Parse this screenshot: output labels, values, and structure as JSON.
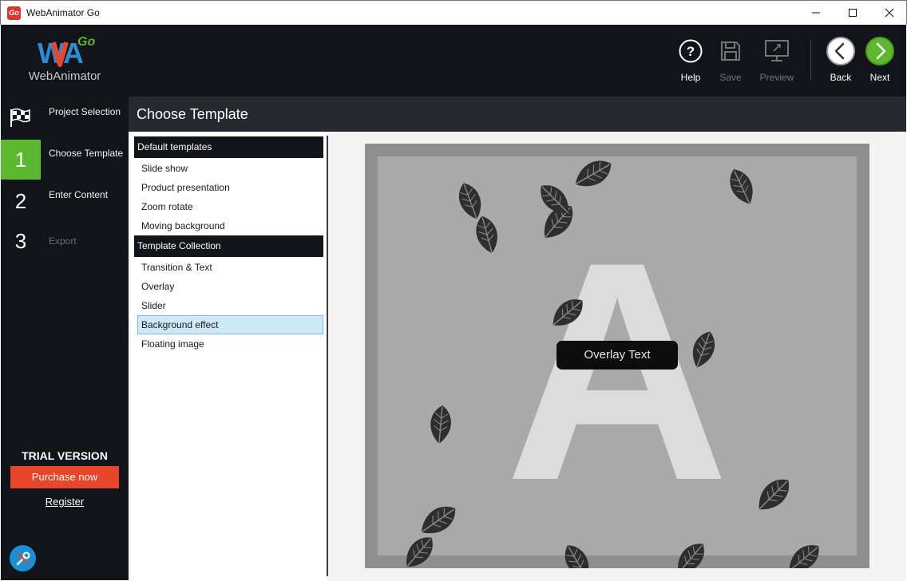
{
  "window": {
    "title": "WebAnimator Go",
    "app_icon_text": "Go"
  },
  "logo": {
    "brand": "WebAnimator",
    "badge": "Go",
    "mark": "WA"
  },
  "sidebar": {
    "items": [
      {
        "label": "Project Selection",
        "icon": "checkered-flag-icon"
      },
      {
        "number": "1",
        "label": "Choose Template"
      },
      {
        "number": "2",
        "label": "Enter Content"
      },
      {
        "number": "3",
        "label": "Export"
      }
    ],
    "trial_label": "TRIAL VERSION",
    "purchase_label": "Purchase now",
    "register_label": "Register",
    "tools_icon": "tools-icon"
  },
  "toolbar": {
    "help_label": "Help",
    "save_label": "Save",
    "preview_label": "Preview",
    "back_label": "Back",
    "next_label": "Next"
  },
  "section": {
    "title": "Choose Template"
  },
  "templates": {
    "default_group": "Default templates",
    "default_items": [
      "Slide show",
      "Product presentation",
      "Zoom rotate",
      "Moving background"
    ],
    "collection_group": "Template Collection",
    "collection_items": [
      "Transition & Text",
      "Overlay",
      "Slider",
      "Background effect",
      "Floating image"
    ],
    "selected": "Background effect"
  },
  "preview": {
    "letter": "A",
    "overlay_text": "Overlay Text"
  },
  "colors": {
    "accent_green": "#5cb82e",
    "purchase_orange": "#e8462a",
    "dark_bg": "#111418",
    "selection_blue": "#cde8f7"
  }
}
